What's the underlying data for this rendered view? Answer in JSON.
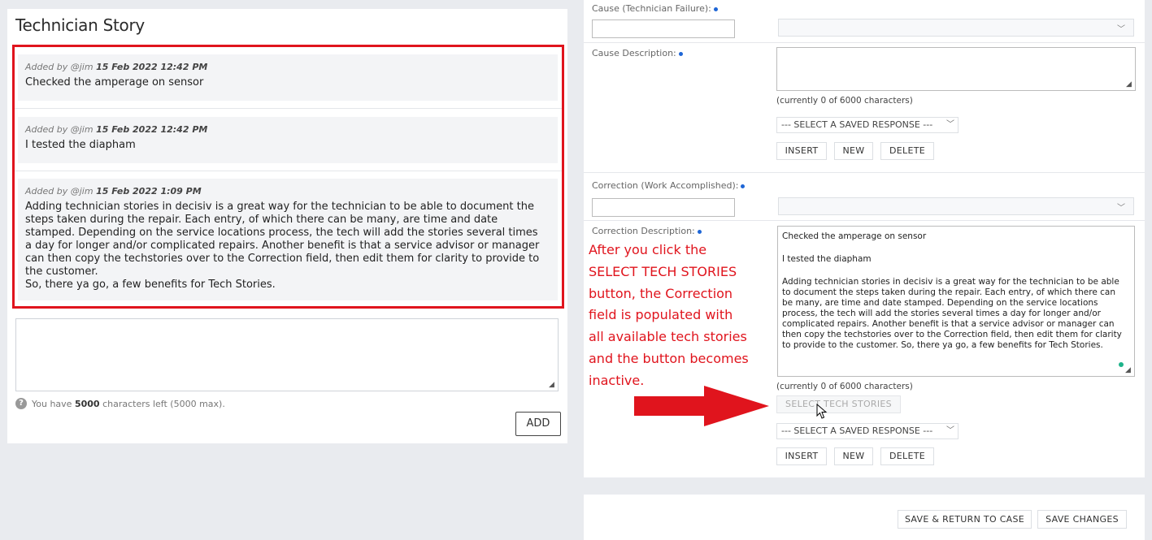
{
  "technician_story": {
    "title": "Technician Story",
    "stories": [
      {
        "added_by": "Added by @jim",
        "timestamp": "15 Feb 2022 12:42 PM",
        "text": "Checked the amperage on sensor"
      },
      {
        "added_by": "Added by @jim",
        "timestamp": "15 Feb 2022 12:42 PM",
        "text": "I tested the diapham"
      },
      {
        "added_by": "Added by @jim",
        "timestamp": "15 Feb 2022 1:09 PM",
        "text_lines": [
          "Adding technician stories in decisiv is a great way for the technician to be able to document the",
          "steps taken during the repair. Each entry, of which there can be many, are time and date",
          "stamped. Depending on the service locations process, the tech will add the stories several times",
          "a day for longer and/or complicated repairs. Another benefit is that a service advisor or manager",
          "can then copy the techstories over to the Correction field, then edit them for clarity to provide to",
          "the customer.",
          "So, there ya go, a few benefits for Tech Stories."
        ]
      }
    ],
    "char_help_prefix": "You have",
    "char_help_count": "5000",
    "char_help_suffix": "characters left (5000 max).",
    "add_label": "ADD"
  },
  "cause": {
    "failure_label": "Cause (Technician Failure):",
    "description_label": "Cause Description:",
    "counter": "(currently 0 of 6000 characters)",
    "saved_response": "--- SELECT A SAVED RESPONSE ---",
    "insert_label": "INSERT",
    "new_label": "NEW",
    "delete_label": "DELETE"
  },
  "correction": {
    "work_label": "Correction (Work Accomplished):",
    "description_label": "Correction Description:",
    "text_paragraphs": [
      "Checked the amperage on sensor",
      "I tested the diapham",
      "Adding technician stories in decisiv is a great way for the technician to be able to document the steps taken during the repair. Each entry, of which there can be many, are time and date stamped. Depending on the service locations process, the tech will add the stories several times a day for longer and/or complicated repairs. Another benefit is that a service advisor or manager can then copy the techstories over to the Correction field, then edit them for clarity to provide to the customer. So, there ya go, a few benefits for Tech Stories."
    ],
    "counter": "(currently 0 of 6000 characters)",
    "select_tech_stories_label": "SELECT TECH STORIES",
    "saved_response": "--- SELECT A SAVED RESPONSE ---",
    "insert_label": "INSERT",
    "new_label": "NEW",
    "delete_label": "DELETE"
  },
  "footer": {
    "save_return_label": "SAVE & RETURN TO CASE",
    "save_changes_label": "SAVE CHANGES"
  },
  "annotation": {
    "lines": [
      "After you click the",
      "SELECT TECH STORIES",
      "button, the Correction",
      "field is populated with",
      "all available tech stories",
      "and the button becomes",
      "inactive."
    ],
    "color": "#e0141d"
  },
  "icons": [
    "help-icon",
    "chevron-down-icon",
    "resize-grip-icon",
    "arrow-right-icon",
    "mouse-cursor-icon"
  ]
}
